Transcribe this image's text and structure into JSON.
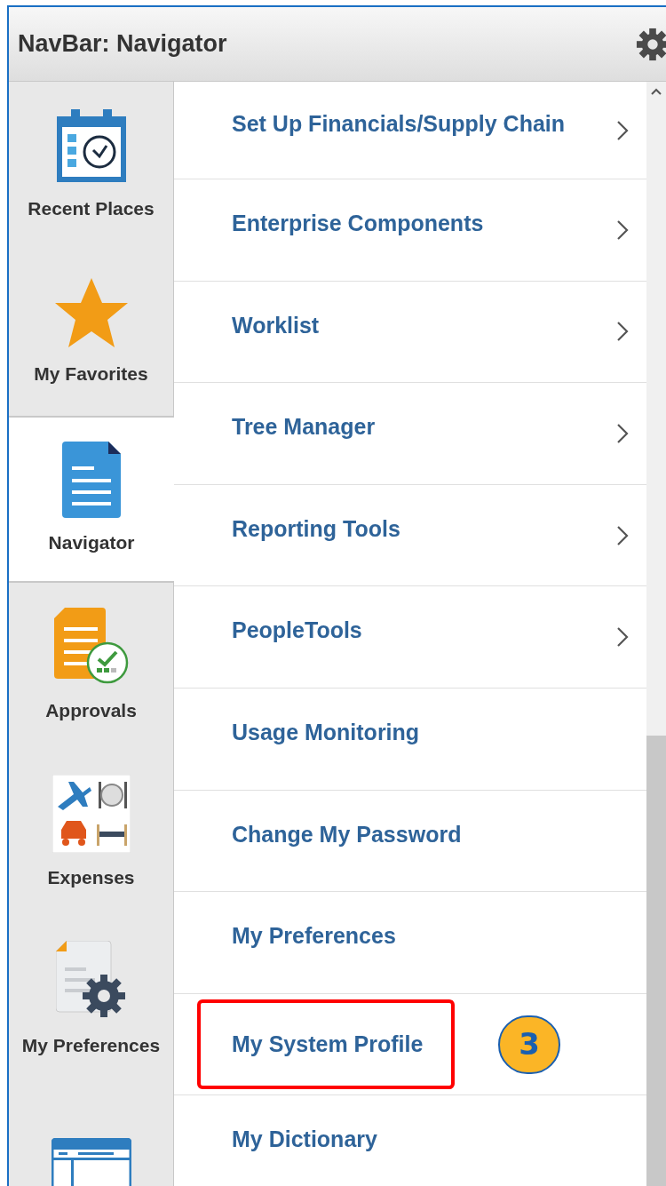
{
  "header": {
    "title": "NavBar: Navigator"
  },
  "sidebar": {
    "items": [
      {
        "kind": "recent",
        "label": "Recent Places",
        "selected": false
      },
      {
        "kind": "favorites",
        "label": "My Favorites",
        "selected": false
      },
      {
        "kind": "navigator",
        "label": "Navigator",
        "selected": true
      },
      {
        "kind": "approvals",
        "label": "Approvals",
        "selected": false
      },
      {
        "kind": "expenses",
        "label": "Expenses",
        "selected": false
      },
      {
        "kind": "preferences",
        "label": "My Preferences",
        "selected": false
      },
      {
        "kind": "window",
        "selected": false
      }
    ]
  },
  "menu": {
    "items": [
      {
        "label": "Set Up Financials/Supply Chain",
        "has_arrow": true,
        "highlighted": false
      },
      {
        "label": "Enterprise Components",
        "has_arrow": true,
        "highlighted": false
      },
      {
        "label": "Worklist",
        "has_arrow": true,
        "highlighted": false
      },
      {
        "label": "Tree Manager",
        "has_arrow": true,
        "highlighted": false
      },
      {
        "label": "Reporting Tools",
        "has_arrow": true,
        "highlighted": false
      },
      {
        "label": "PeopleTools",
        "has_arrow": true,
        "highlighted": false
      },
      {
        "label": "Usage Monitoring",
        "has_arrow": false,
        "highlighted": false
      },
      {
        "label": "Change My Password",
        "has_arrow": false,
        "highlighted": false
      },
      {
        "label": "My Preferences",
        "has_arrow": false,
        "highlighted": false
      },
      {
        "label": "My System Profile",
        "has_arrow": false,
        "highlighted": true,
        "callout": "3"
      },
      {
        "label": "My Dictionary",
        "has_arrow": false,
        "highlighted": false
      }
    ]
  }
}
